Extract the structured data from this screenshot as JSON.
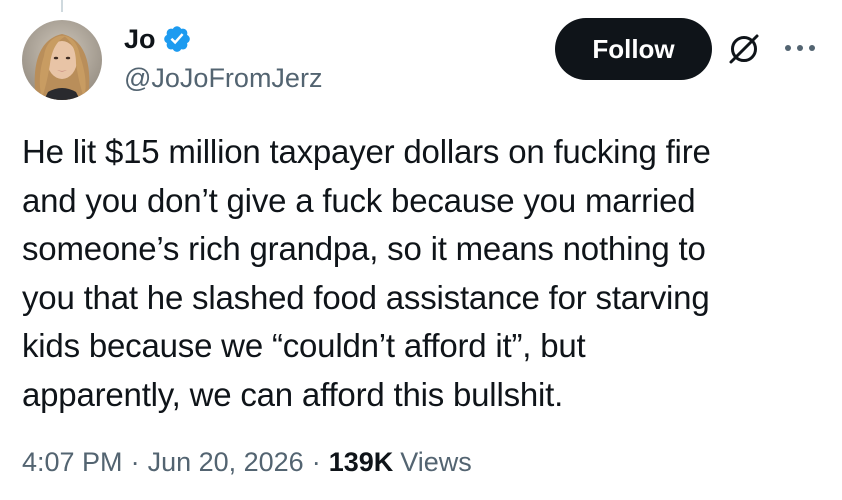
{
  "author": {
    "name": "Jo",
    "handle": "@JoJoFromJerz",
    "verified": true
  },
  "actions": {
    "follow_label": "Follow"
  },
  "icons": {
    "verified": "verified-badge-icon",
    "grok": "grok-icon",
    "more": "more-options-icon"
  },
  "tweet": {
    "text": "He lit $15 million taxpayer dollars on fucking fire\nand you don’t give a fuck because you married\nsomeone’s rich grandpa, so it means nothing to\nyou that he slashed food assistance for starving\nkids because we “couldn’t afford it”, but\napparently, we can afford this bullshit."
  },
  "meta": {
    "time": "4:07 PM",
    "separator": "·",
    "date": "Jun 20, 2026",
    "views_count": "139K",
    "views_label": "Views"
  },
  "colors": {
    "text_primary": "#0f1419",
    "text_secondary": "#536471",
    "verified_blue": "#1d9bf0",
    "button_bg": "#0f1419"
  }
}
